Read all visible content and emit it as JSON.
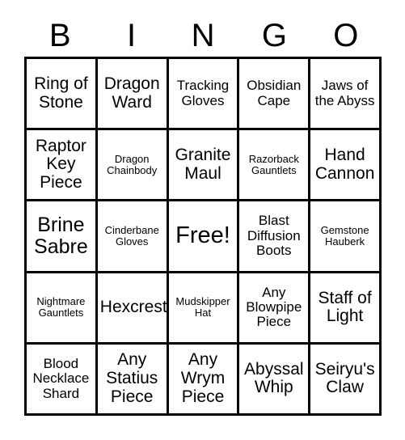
{
  "header": {
    "letters": [
      "B",
      "I",
      "N",
      "G",
      "O"
    ]
  },
  "grid": {
    "columns": 5,
    "rows": 5,
    "border_color": "#000000",
    "background_color": "#ffffff",
    "text_color": "#000000",
    "cells": [
      {
        "text": "Ring of Stone",
        "size": "md"
      },
      {
        "text": "Dragon Ward",
        "size": "md"
      },
      {
        "text": "Tracking Gloves",
        "size": "sm"
      },
      {
        "text": "Obsidian Cape",
        "size": "sm"
      },
      {
        "text": "Jaws of the Abyss",
        "size": "sm"
      },
      {
        "text": "Raptor Key Piece",
        "size": "md"
      },
      {
        "text": "Dragon Chainbody",
        "size": "xs"
      },
      {
        "text": "Granite Maul",
        "size": "md"
      },
      {
        "text": "Razorback Gauntlets",
        "size": "xs"
      },
      {
        "text": "Hand Cannon",
        "size": "md"
      },
      {
        "text": "Brine Sabre",
        "size": "lg"
      },
      {
        "text": "Cinderbane Gloves",
        "size": "xs"
      },
      {
        "text": "Free!",
        "size": "xl"
      },
      {
        "text": "Blast Diffusion Boots",
        "size": "sm"
      },
      {
        "text": "Gemstone Hauberk",
        "size": "xs"
      },
      {
        "text": "Nightmare Gauntlets",
        "size": "xs"
      },
      {
        "text": "Hexcrest",
        "size": "md"
      },
      {
        "text": "Mudskipper Hat",
        "size": "xs"
      },
      {
        "text": "Any Blowpipe Piece",
        "size": "sm"
      },
      {
        "text": "Staff of Light",
        "size": "md"
      },
      {
        "text": "Blood Necklace Shard",
        "size": "sm"
      },
      {
        "text": "Any Statius Piece",
        "size": "md"
      },
      {
        "text": "Any Wrym Piece",
        "size": "md"
      },
      {
        "text": "Abyssal Whip",
        "size": "md"
      },
      {
        "text": "Seiryu's Claw",
        "size": "md"
      }
    ]
  }
}
